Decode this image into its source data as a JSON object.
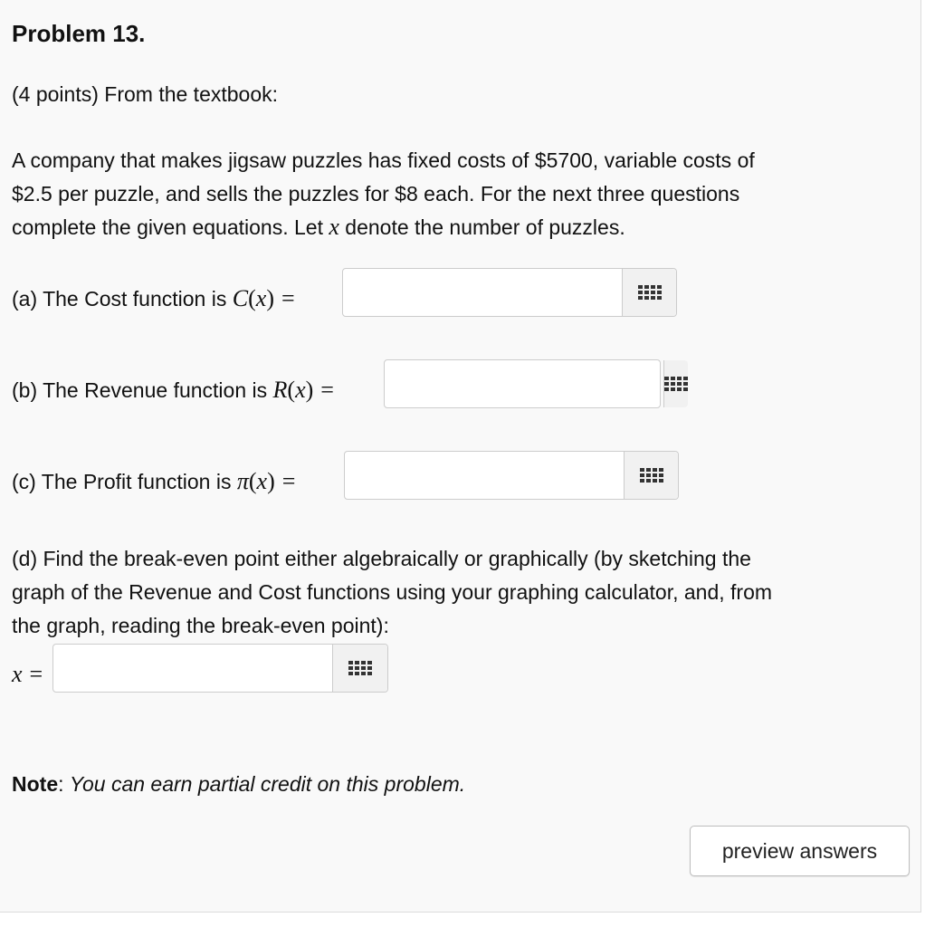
{
  "problem": {
    "title": "Problem 13.",
    "points_line": "(4 points) From the textbook:",
    "statement": [
      "A company that makes jigsaw puzzles has fixed costs of $5700, variable costs of",
      "$2.5 per puzzle, and sells the puzzles for $8 each. For the next three questions"
    ],
    "statement_line3_prefix": "complete the given equations. Let ",
    "statement_line3_var": "x",
    "statement_line3_suffix": " denote the number of puzzles."
  },
  "parts": [
    {
      "label": "(a) The Cost function is ",
      "func": "C",
      "arg": "x",
      "eq": "=",
      "value": ""
    },
    {
      "label": "(b) The Revenue function is ",
      "func": "R",
      "arg": "x",
      "eq": "=",
      "value": ""
    },
    {
      "label": "(c) The Profit function is ",
      "func": "π",
      "arg": "x",
      "eq": "=",
      "value": ""
    }
  ],
  "part_d": {
    "lines": [
      "(d) Find the break-even point either algebraically or graphically (by sketching the",
      "graph of the Revenue and Cost functions using your graphing calculator, and, from",
      "the graph, reading the break-even point):"
    ],
    "var": "x",
    "eq": "=",
    "value": ""
  },
  "note": {
    "bold": "Note",
    "colon": ": ",
    "text": "You can earn partial credit on this problem."
  },
  "buttons": {
    "preview": "preview answers"
  },
  "icons": {
    "keypad": "keypad-grid-icon"
  }
}
